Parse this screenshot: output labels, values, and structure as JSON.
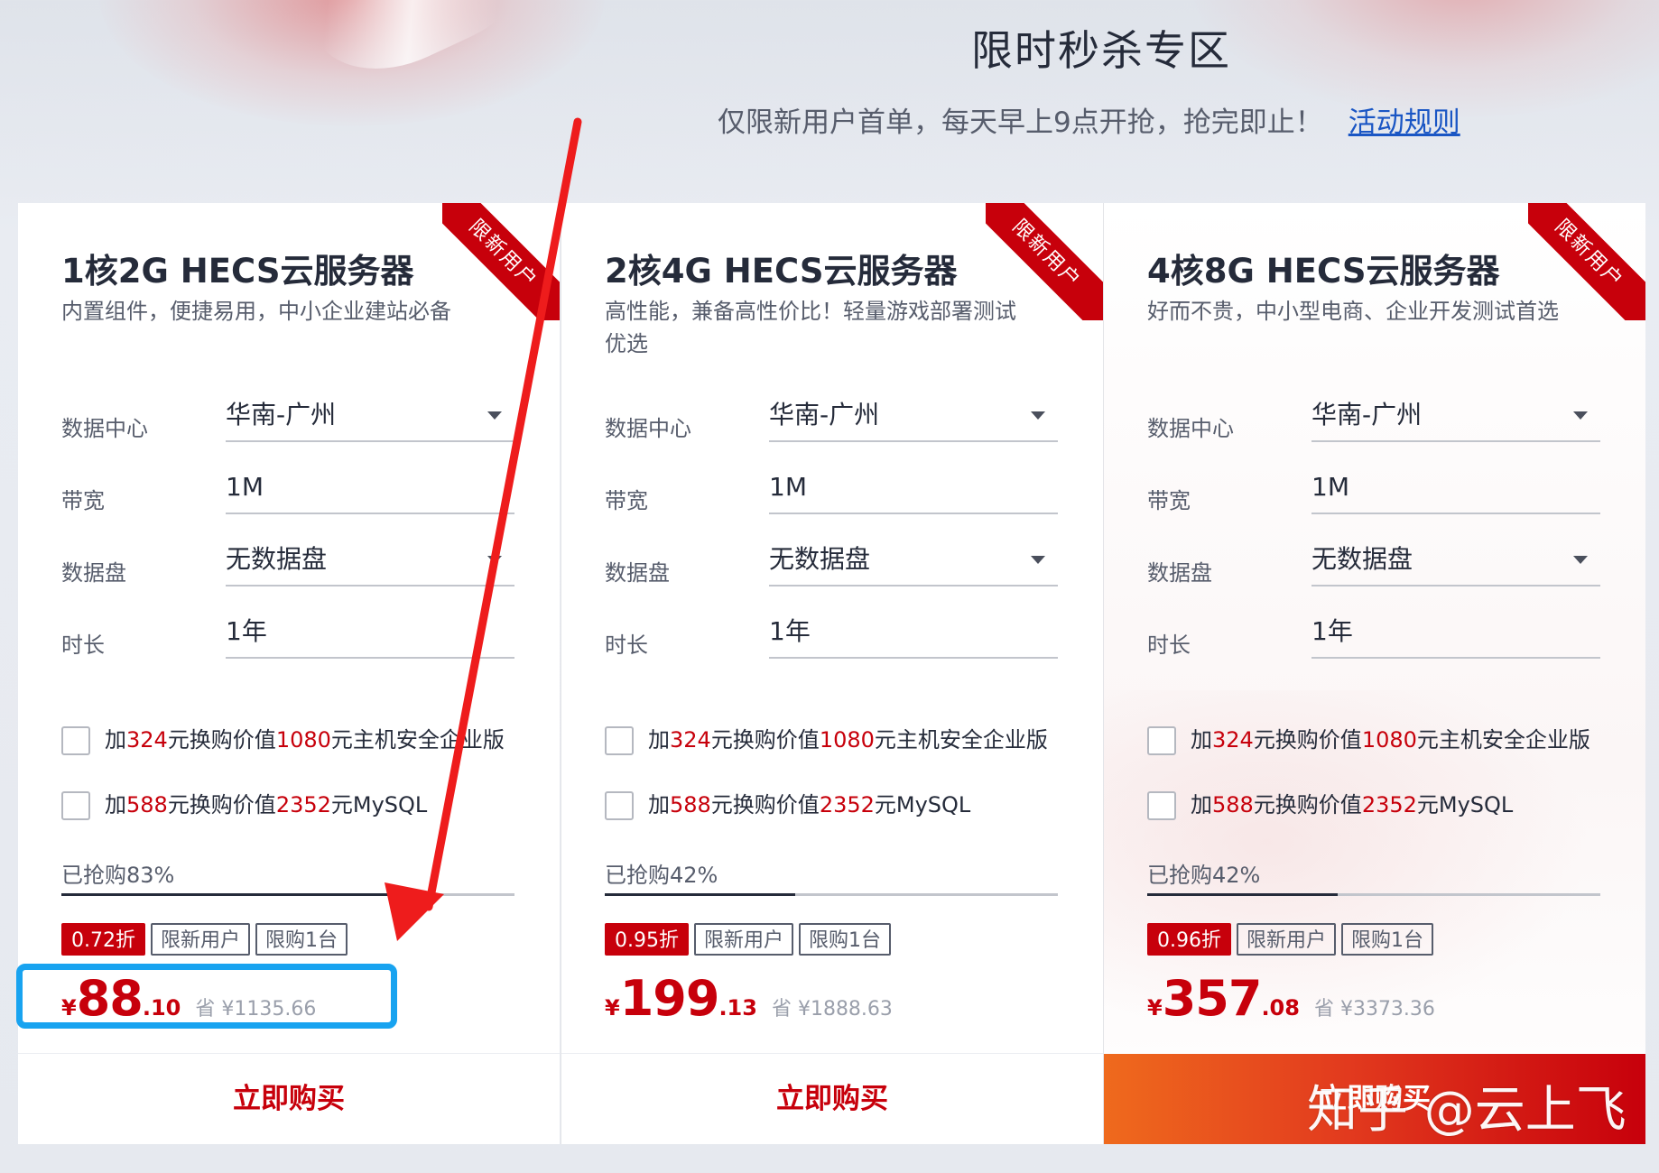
{
  "page": {
    "title": "限时秒杀专区",
    "subtitle": "仅限新用户首单，每天早上9点开抢，抢完即止！",
    "rules_link": "活动规则",
    "watermark": "知乎 @云上飞",
    "colors": {
      "accent": "#c7000b",
      "annotation_arrow": "#ee1c1c",
      "annotation_box": "#18a3f0"
    }
  },
  "labels": {
    "ribbon": "限新用户",
    "datacenter": "数据中心",
    "bandwidth": "带宽",
    "datadisk": "数据盘",
    "duration": "时长",
    "buy_button": "立即购买",
    "tag_newuser": "限新用户",
    "tag_limit": "限购1台",
    "addon1_a": "加",
    "addon1_b": "324",
    "addon1_c": "元换购价值",
    "addon1_d": "1080",
    "addon1_e": "元主机安全企业版",
    "addon2_a": "加",
    "addon2_b": "588",
    "addon2_c": "元换购价值",
    "addon2_d": "2352",
    "addon2_e": "元MySQL",
    "currency": "¥"
  },
  "cards": [
    {
      "title": "1核2G HECS云服务器",
      "desc": "内置组件，便捷易用，中小企业建站必备",
      "datacenter": "华南-广州",
      "bandwidth": "1M",
      "datadisk": "无数据盘",
      "duration": "1年",
      "sold_text": "已抢购83%",
      "sold_percent": 83,
      "discount": "0.72折",
      "price_int": "88",
      "price_dec": ".10",
      "save": "省 ¥1135.66"
    },
    {
      "title": "2核4G HECS云服务器",
      "desc": "高性能，兼备高性价比！轻量游戏部署测试优选",
      "datacenter": "华南-广州",
      "bandwidth": "1M",
      "datadisk": "无数据盘",
      "duration": "1年",
      "sold_text": "已抢购42%",
      "sold_percent": 42,
      "discount": "0.95折",
      "price_int": "199",
      "price_dec": ".13",
      "save": "省 ¥1888.63"
    },
    {
      "title": "4核8G HECS云服务器",
      "desc": "好而不贵，中小型电商、企业开发测试首选",
      "datacenter": "华南-广州",
      "bandwidth": "1M",
      "datadisk": "无数据盘",
      "duration": "1年",
      "sold_text": "已抢购42%",
      "sold_percent": 42,
      "discount": "0.96折",
      "price_int": "357",
      "price_dec": ".08",
      "save": "省 ¥3373.36"
    }
  ]
}
